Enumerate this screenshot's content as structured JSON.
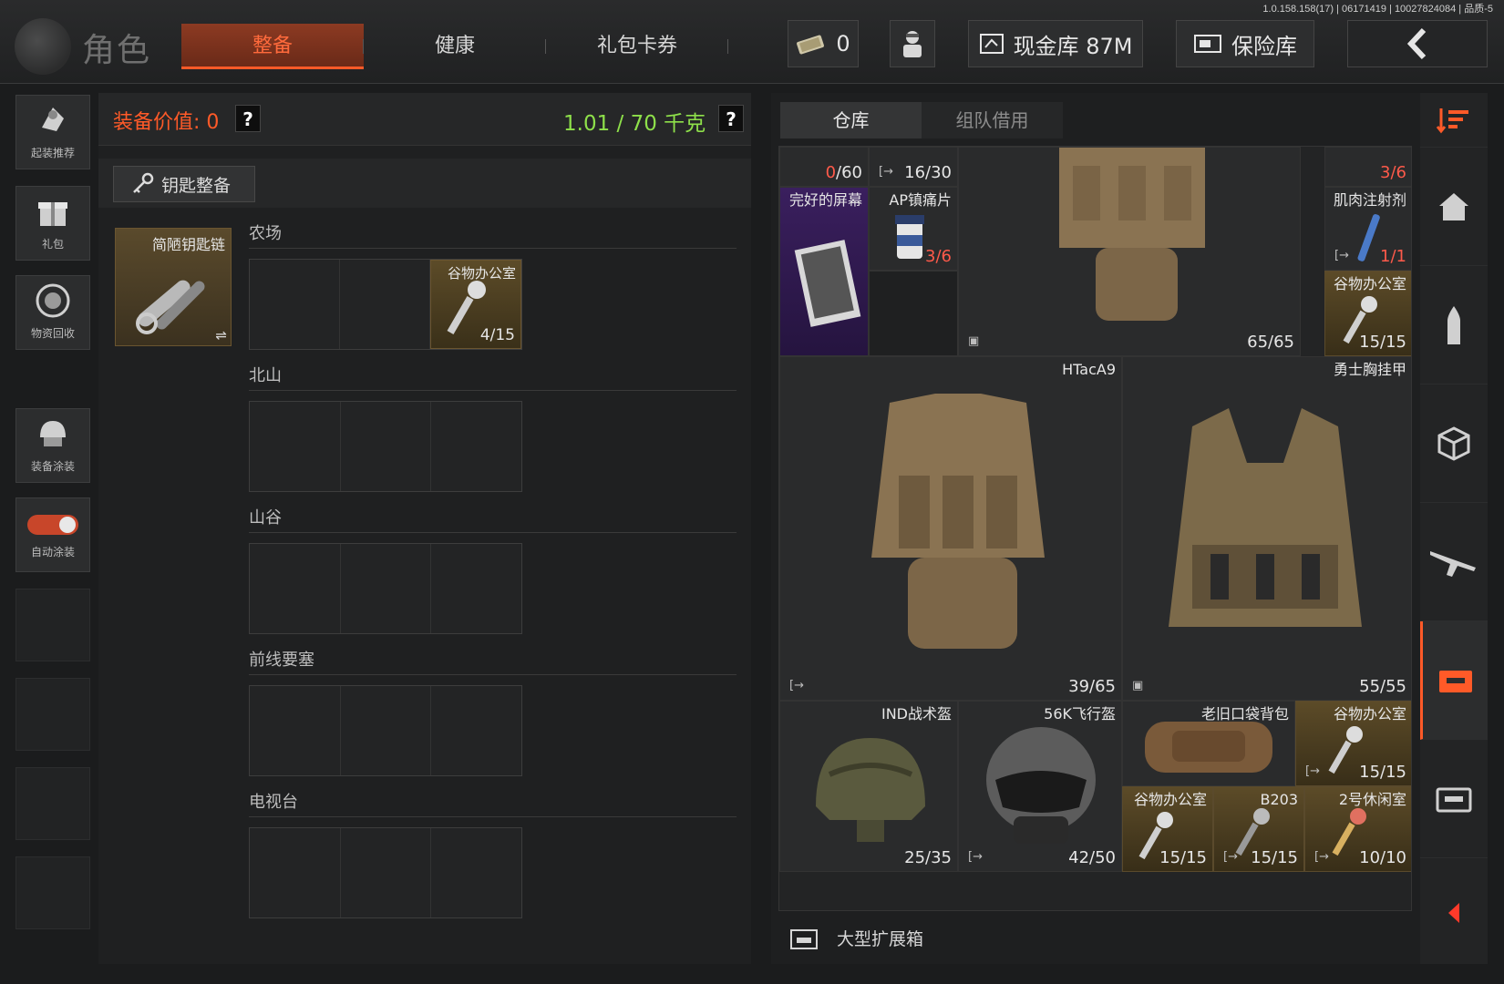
{
  "build_info": "1.0.158.158(17) | 06171419 | 10027824084 | 品质-5",
  "header": {
    "title": "角色",
    "tabs": [
      {
        "label": "整备",
        "active": true
      },
      {
        "label": "健康",
        "active": false
      },
      {
        "label": "礼包卡券",
        "active": false
      }
    ],
    "currency_value": "0",
    "cash_label": "现金库 87M",
    "safe_label": "保险库",
    "accent_color": "#ff5a28"
  },
  "left_rail": [
    {
      "label": "起装推荐",
      "icon": "soldier-icon"
    },
    {
      "label": "礼包",
      "icon": "gift-icon"
    },
    {
      "label": "物资回收",
      "icon": "recycle-icon"
    },
    {
      "label": "装备涂装",
      "icon": "helmet-icon"
    },
    {
      "label": "自动涂装",
      "icon": "toggle-icon"
    }
  ],
  "equipment": {
    "value_label": "装备价值: 0",
    "weight_label": "1.01 / 70 千克",
    "help": "?",
    "key_button": "钥匙整备",
    "keychain_label": "简陋钥匙链",
    "maps": [
      {
        "name": "农场",
        "key_name": "谷物办公室",
        "key_count": "4/15"
      },
      {
        "name": "北山"
      },
      {
        "name": "山谷"
      },
      {
        "name": "前线要塞"
      },
      {
        "name": "电视台"
      }
    ]
  },
  "warehouse": {
    "tabs": [
      "仓库",
      "组队借用"
    ],
    "items": {
      "top1": {
        "count_red": "0",
        "count": "/60"
      },
      "top2": {
        "count": "16/30"
      },
      "top3": {
        "count": "3/6"
      },
      "screen": {
        "name": "完好的屏幕"
      },
      "painkiller": {
        "name": "AP镇痛片",
        "count": "3/6"
      },
      "vest_top": {
        "count": "65/65"
      },
      "muscle": {
        "name": "肌肉注射剂",
        "count": "1/1"
      },
      "key_office1": {
        "name": "谷物办公室",
        "count": "15/15"
      },
      "htac": {
        "name": "HTacA9",
        "count": "39/65"
      },
      "warrior": {
        "name": "勇士胸挂甲",
        "count": "55/55"
      },
      "ind": {
        "name": "IND战术盔",
        "count": "25/35"
      },
      "k56": {
        "name": "56K飞行盔",
        "count": "42/50"
      },
      "bag": {
        "name": "老旧口袋背包"
      },
      "key_office2": {
        "name": "谷物办公室",
        "count": "15/15"
      },
      "key_office3": {
        "name": "谷物办公室",
        "count": "15/15"
      },
      "b203": {
        "name": "B203",
        "count": "15/15"
      },
      "lounge": {
        "name": "2号休闲室",
        "count": "10/10"
      }
    },
    "footer": "大型扩展箱"
  }
}
